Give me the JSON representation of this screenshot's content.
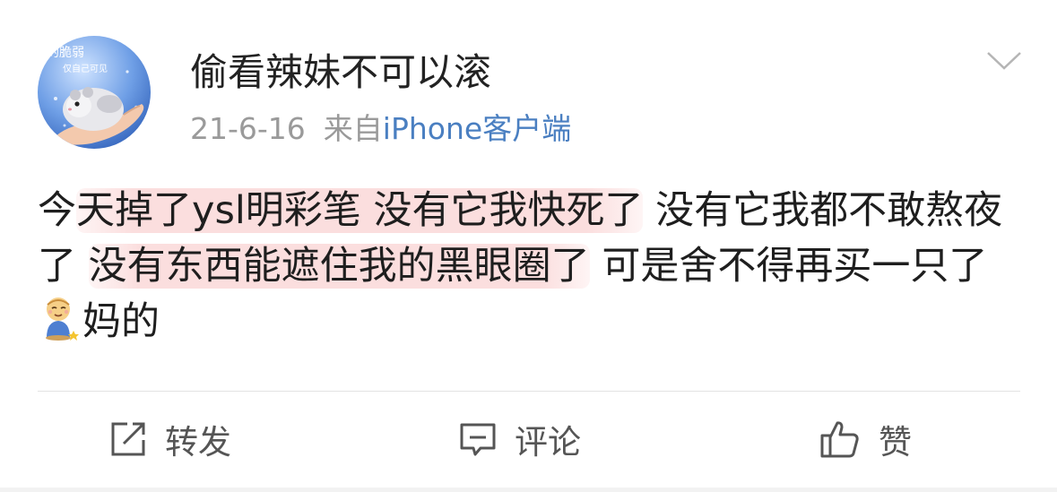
{
  "post": {
    "username": "偷看辣妹不可以滚",
    "date": "21-6-16",
    "source_prefix": "来自",
    "source_name": "iPhone客户端",
    "text_segments": [
      {
        "text": "今",
        "highlight": false
      },
      {
        "text": "天掉了ysl明彩笔 没有它我快死了",
        "highlight": true
      },
      {
        "text": " 没有它我都不敢熬夜了 ",
        "highlight": false
      },
      {
        "text": "没有东西能遮住我的黑眼圈了",
        "highlight": true
      },
      {
        "text": " 可是舍不得再买一只了 ",
        "highlight": false
      },
      {
        "text": "[emoji]",
        "emoji": "praying-child-emoji"
      },
      {
        "text": "妈的",
        "highlight": false
      }
    ]
  },
  "avatar": {
    "caption_top": "的脆弱",
    "caption_sub": "仅自己可见",
    "image": "hamster-in-hand"
  },
  "actions": {
    "forward_label": "转发",
    "comment_label": "评论",
    "like_label": "赞"
  },
  "icons": {
    "more": "chevron-down-icon",
    "forward": "share-arrow-icon",
    "comment": "comment-bubble-icon",
    "like": "thumbs-up-icon"
  },
  "colors": {
    "link": "#4a7fc1",
    "meta": "#9a9a9a",
    "highlight": "#fbdede",
    "text": "#1e1e1e"
  }
}
